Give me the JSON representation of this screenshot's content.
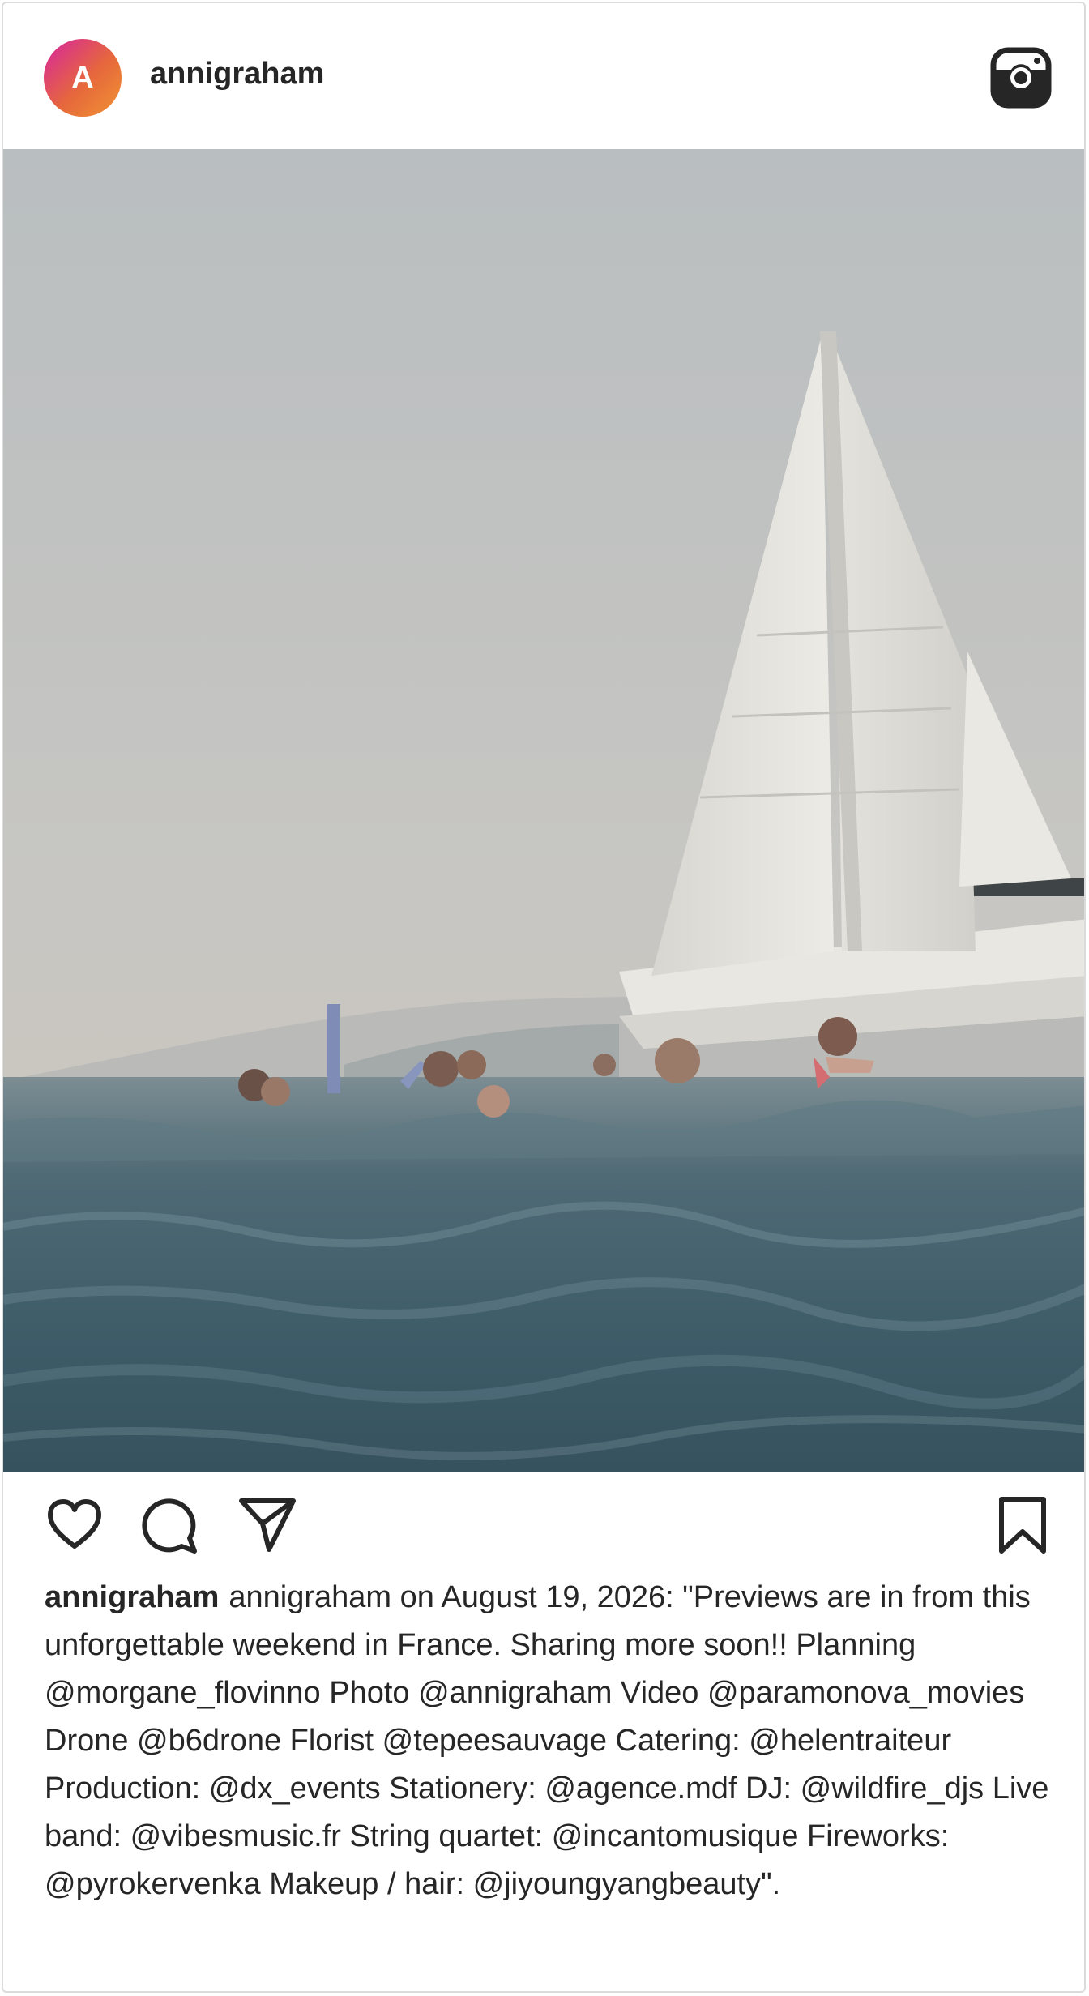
{
  "post": {
    "avatar_initial": "A",
    "username": "annigraham",
    "header_icon": "instagram-icon",
    "photo_icon": "photo-sailboat-swimmers",
    "actions": {
      "like_icon": "heart-icon",
      "comment_icon": "comment-icon",
      "share_icon": "share-icon",
      "save_icon": "bookmark-icon"
    },
    "caption_username": "annigraham",
    "caption_text": "annigraham on August 19, 2026: \"Previews are in from this unforgettable weekend in France. Sharing more soon!! Planning @morgane_flovinno Photo @annigraham Video @paramonova_movies Drone @b6drone Florist @tepeesauvage Catering: @helentraiteur Production: @dx_events Stationery: @agence.mdf DJ: @wildfire_djs Live band: @vibesmusic.fr String quartet: @incantomusique Fireworks: @pyrokervenka Makeup / hair: @jiyoungyangbeauty\"."
  },
  "colors": {
    "avatar_gradient": [
      "#d6249f",
      "#e6683c",
      "#f09433"
    ],
    "text": "#262626",
    "border": "#dbdbdb"
  }
}
